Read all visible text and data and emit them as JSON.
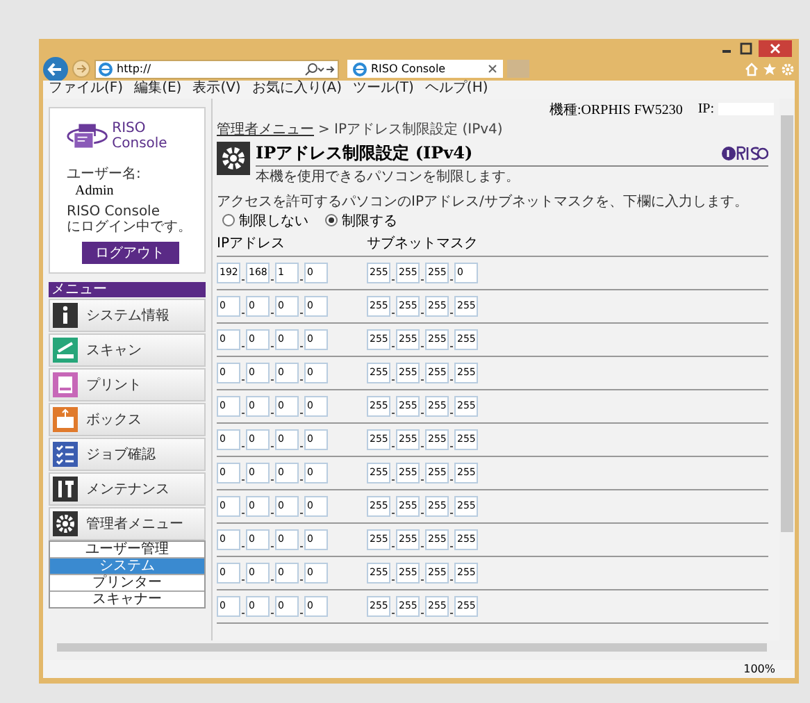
{
  "browser": {
    "address": "http://",
    "tab_title": "RISO Console",
    "menu": [
      "ファイル(F)",
      "編集(E)",
      "表示(V)",
      "お気に入り(A)",
      "ツール(T)",
      "ヘルプ(H)"
    ],
    "zoom": "100%"
  },
  "header": {
    "model": "機種:ORPHIS FW5230",
    "ip_label": "IP:"
  },
  "sidebar": {
    "logo_text": "RISO Console",
    "user_label": "ユーザー名:",
    "user": "Admin",
    "status": [
      "RISO Console",
      "にログイン中です。"
    ],
    "logout_button": "ログアウト",
    "menu_title": "メニュー",
    "menu": [
      {
        "label": "システム情報",
        "kind": "info"
      },
      {
        "label": "スキャン",
        "kind": "scan"
      },
      {
        "label": "プリント",
        "kind": "print"
      },
      {
        "label": "ボックス",
        "kind": "box"
      },
      {
        "label": "ジョブ確認",
        "kind": "job"
      },
      {
        "label": "メンテナンス",
        "kind": "tools"
      },
      {
        "label": "管理者メニュー",
        "kind": "admin"
      }
    ],
    "submenu": [
      {
        "label": "ユーザー管理",
        "selected": false
      },
      {
        "label": "システム",
        "selected": true
      },
      {
        "label": "プリンター",
        "selected": false
      },
      {
        "label": "スキャナー",
        "selected": false
      }
    ]
  },
  "main": {
    "breadcrumb_link": "管理者メニュー",
    "breadcrumb_rest": "> IPアドレス制限設定 (IPv4)",
    "title": "IPアドレス制限設定 (IPv4)",
    "subtitle": "本機を使用できるパソコンを制限します。",
    "instruction": "アクセスを許可するパソコンのIPアドレス/サブネットマスクを、下欄に入力します。",
    "radios": [
      {
        "label": "制限しない",
        "selected": false
      },
      {
        "label": "制限する",
        "selected": true
      }
    ],
    "columns": [
      "IPアドレス",
      "サブネットマスク"
    ],
    "rows": [
      {
        "ip": [
          "192",
          "168",
          "1",
          "0"
        ],
        "mask": [
          "255",
          "255",
          "255",
          "0"
        ]
      },
      {
        "ip": [
          "0",
          "0",
          "0",
          "0"
        ],
        "mask": [
          "255",
          "255",
          "255",
          "255"
        ]
      },
      {
        "ip": [
          "0",
          "0",
          "0",
          "0"
        ],
        "mask": [
          "255",
          "255",
          "255",
          "255"
        ]
      },
      {
        "ip": [
          "0",
          "0",
          "0",
          "0"
        ],
        "mask": [
          "255",
          "255",
          "255",
          "255"
        ]
      },
      {
        "ip": [
          "0",
          "0",
          "0",
          "0"
        ],
        "mask": [
          "255",
          "255",
          "255",
          "255"
        ]
      },
      {
        "ip": [
          "0",
          "0",
          "0",
          "0"
        ],
        "mask": [
          "255",
          "255",
          "255",
          "255"
        ]
      },
      {
        "ip": [
          "0",
          "0",
          "0",
          "0"
        ],
        "mask": [
          "255",
          "255",
          "255",
          "255"
        ]
      },
      {
        "ip": [
          "0",
          "0",
          "0",
          "0"
        ],
        "mask": [
          "255",
          "255",
          "255",
          "255"
        ]
      },
      {
        "ip": [
          "0",
          "0",
          "0",
          "0"
        ],
        "mask": [
          "255",
          "255",
          "255",
          "255"
        ]
      },
      {
        "ip": [
          "0",
          "0",
          "0",
          "0"
        ],
        "mask": [
          "255",
          "255",
          "255",
          "255"
        ]
      },
      {
        "ip": [
          "0",
          "0",
          "0",
          "0"
        ],
        "mask": [
          "255",
          "255",
          "255",
          "255"
        ]
      }
    ]
  }
}
